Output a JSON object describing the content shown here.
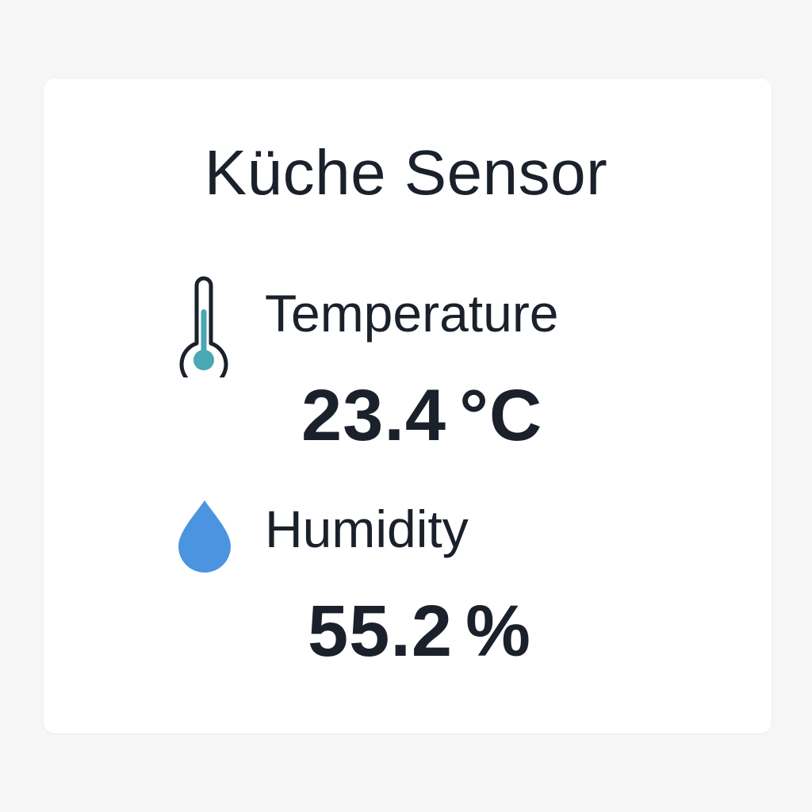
{
  "sensor": {
    "title": "Küche Sensor"
  },
  "temperature": {
    "icon": "thermometer-icon",
    "label": "Temperature",
    "value": "23.4",
    "unit": "°C",
    "accent_color": "#4aa7b4"
  },
  "humidity": {
    "icon": "water-drop-icon",
    "label": "Humidity",
    "value": "55.2",
    "unit": "%",
    "accent_color": "#4a94e0"
  }
}
